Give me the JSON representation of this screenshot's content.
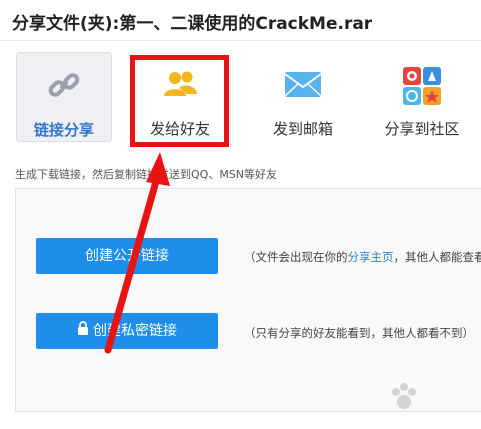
{
  "header": {
    "title": "分享文件(夹):第一、二课使用的CrackMe.rar"
  },
  "tabs": [
    {
      "label": "链接分享",
      "icon": "link-icon",
      "active": true
    },
    {
      "label": "发给好友",
      "icon": "friends-icon",
      "active": false
    },
    {
      "label": "发到邮箱",
      "icon": "mail-icon",
      "active": false
    },
    {
      "label": "分享到社区",
      "icon": "community-icon",
      "active": false
    }
  ],
  "hint": "生成下载链接，然后复制链接发送到QQ、MSN等好友",
  "public_link": {
    "button_label": "创建公开链接",
    "desc_before": "（文件会出现在你的",
    "desc_link": "分享主页",
    "desc_after": "，其他人都能查看"
  },
  "private_link": {
    "button_label": "创建私密链接",
    "lock_icon": "lock-icon",
    "desc": "（只有分享的好友能看到，其他人都看不到）"
  },
  "colors": {
    "accent_blue": "#1e8eea",
    "highlight_red": "#e81313",
    "link_blue": "#2a7fd5"
  }
}
